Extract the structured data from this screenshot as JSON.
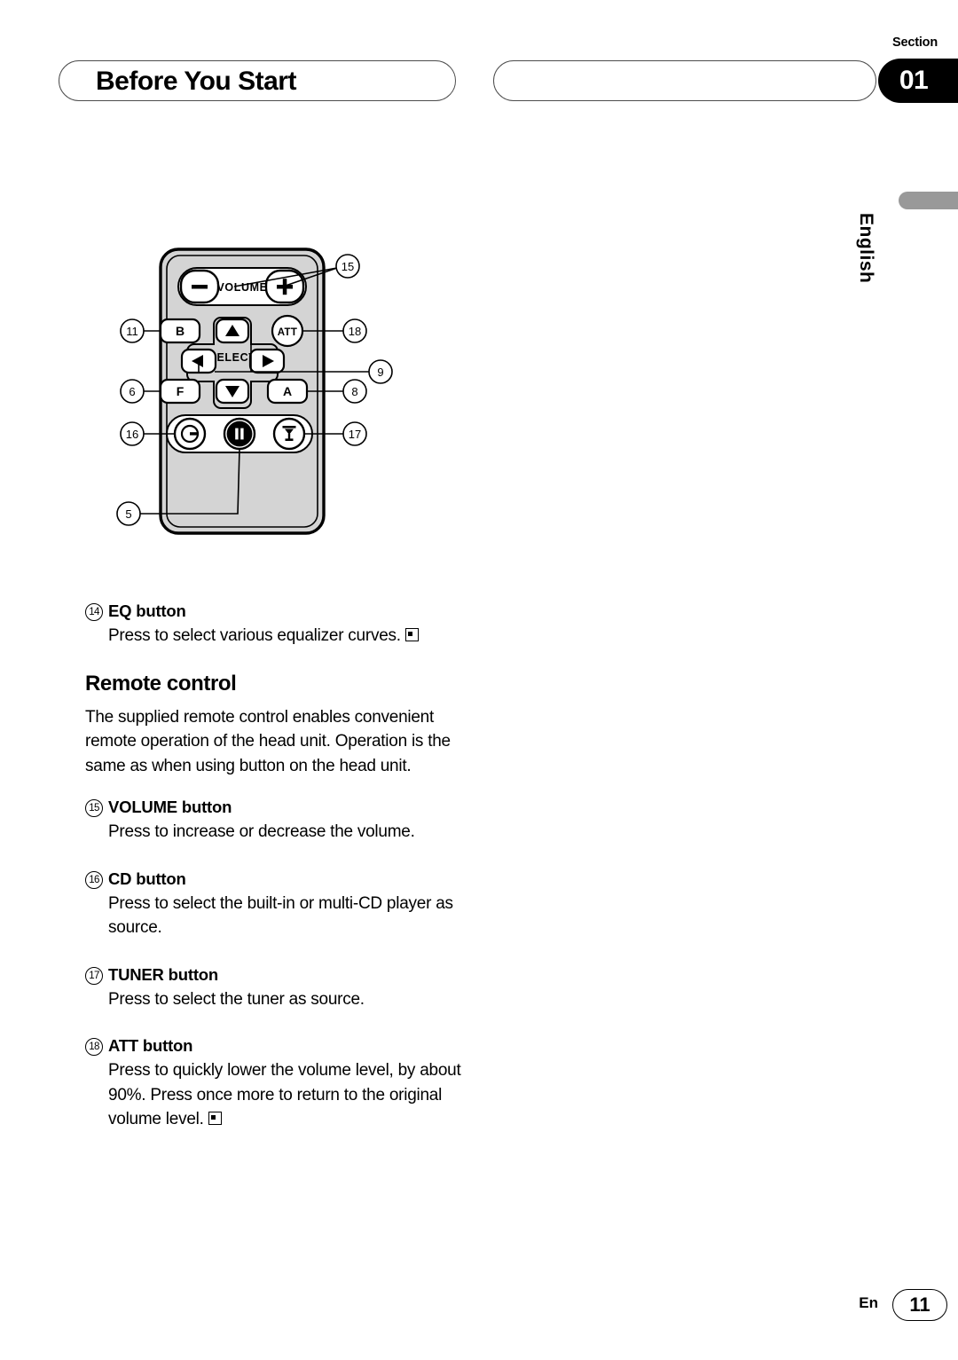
{
  "header": {
    "title": "Before You Start",
    "section_label": "Section",
    "section_number": "01"
  },
  "sidebar": {
    "language": "English"
  },
  "figure": {
    "name": "remote-control-diagram",
    "labels": {
      "volume": "VOLUME",
      "select": "SELECT",
      "att": "ATT",
      "minus": "−",
      "plus": "+",
      "b": "B",
      "f": "F",
      "a": "A",
      "up": "▲",
      "down": "▼",
      "left": "◀",
      "right": "▶",
      "pause": "▐▐"
    },
    "callouts": [
      "15",
      "11",
      "18",
      "9",
      "6",
      "8",
      "16",
      "17",
      "5"
    ]
  },
  "content": {
    "items": [
      {
        "num": "14",
        "title": "EQ button",
        "body": "Press to select various equalizer curves.",
        "endmark": true
      }
    ],
    "section_heading": "Remote control",
    "section_paragraph": "The supplied remote control enables convenient remote operation of the head unit. Operation is the same as when using button on the head unit.",
    "items2": [
      {
        "num": "15",
        "title": "VOLUME button",
        "body": "Press to increase or decrease the volume.",
        "endmark": false
      },
      {
        "num": "16",
        "title": "CD button",
        "body": "Press to select the built-in or multi-CD player as source.",
        "endmark": false
      },
      {
        "num": "17",
        "title": "TUNER button",
        "body": "Press to select the tuner as source.",
        "endmark": false
      },
      {
        "num": "18",
        "title": "ATT button",
        "body": "Press to quickly lower the volume level, by about 90%. Press once more to return to the original volume level.",
        "endmark": true
      }
    ]
  },
  "footer": {
    "language_code": "En",
    "page_number": "11"
  }
}
